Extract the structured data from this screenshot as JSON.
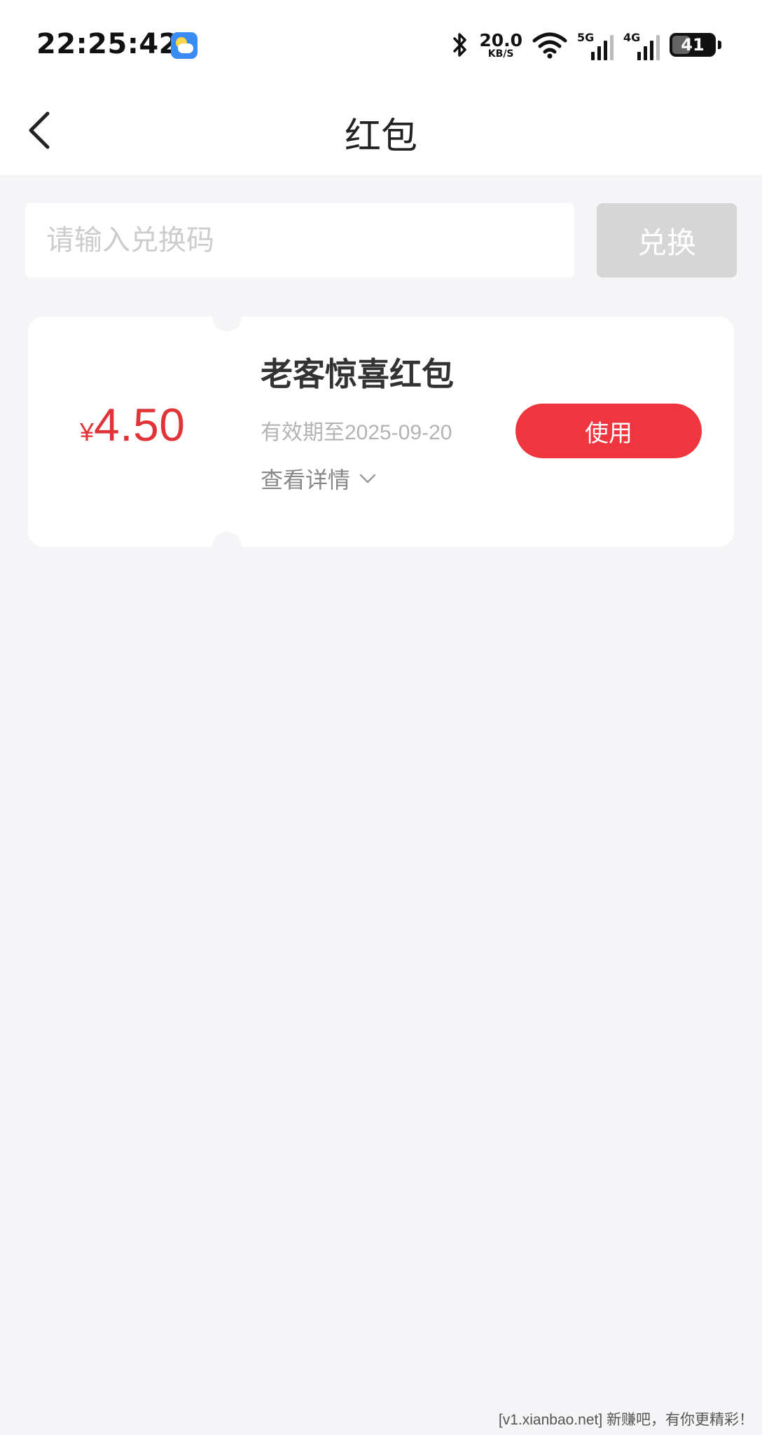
{
  "status_bar": {
    "time": "22:25:42",
    "weather_icon": "weather-partly-cloudy-icon",
    "network_speed_value": "20.0",
    "network_speed_unit": "KB/S",
    "signal_1_label": "5G",
    "signal_2_label": "4G",
    "battery_level": "41"
  },
  "header": {
    "back_icon": "chevron-left-icon",
    "title": "红包"
  },
  "redeem": {
    "placeholder": "请输入兑换码",
    "value": "",
    "button_label": "兑换"
  },
  "coupons": [
    {
      "currency": "¥",
      "amount": "4.50",
      "title": "老客惊喜红包",
      "validity": "有效期至2025-09-20",
      "details_label": "查看详情",
      "use_label": "使用"
    }
  ],
  "colors": {
    "accent": "#ef353d",
    "amount": "#e03438",
    "background": "#f5f5f7",
    "disabled_button": "#d6d6d6"
  },
  "watermark": "[v1.xianbao.net] 新赚吧，有你更精彩！"
}
